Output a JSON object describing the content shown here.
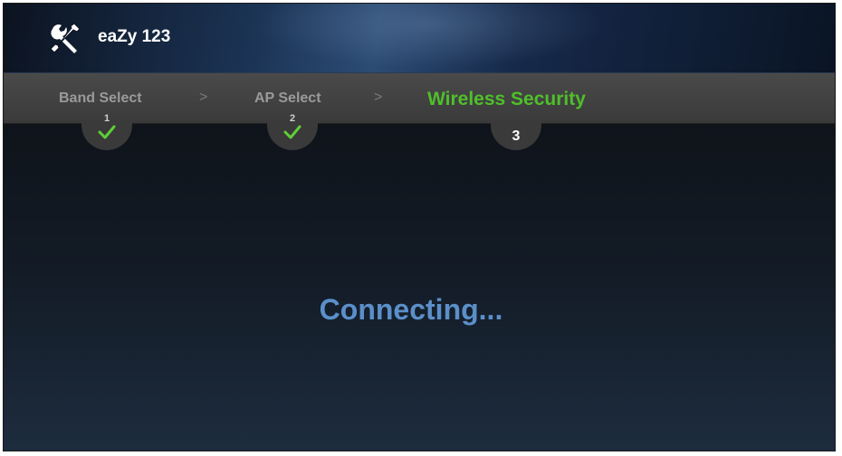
{
  "header": {
    "title": "eaZy 123",
    "icon": "tools-icon"
  },
  "steps": [
    {
      "label": "Band Select",
      "number": "1",
      "completed": true
    },
    {
      "label": "AP Select",
      "number": "2",
      "completed": true
    },
    {
      "label": "Wireless Security",
      "number": "3",
      "completed": false,
      "active": true
    }
  ],
  "separator": ">",
  "status": {
    "text": "Connecting..."
  },
  "colors": {
    "active_step": "#4fbf2a",
    "inactive_step": "#9a9a9a",
    "status_text": "#5b8fc9",
    "check": "#5ecf36"
  }
}
